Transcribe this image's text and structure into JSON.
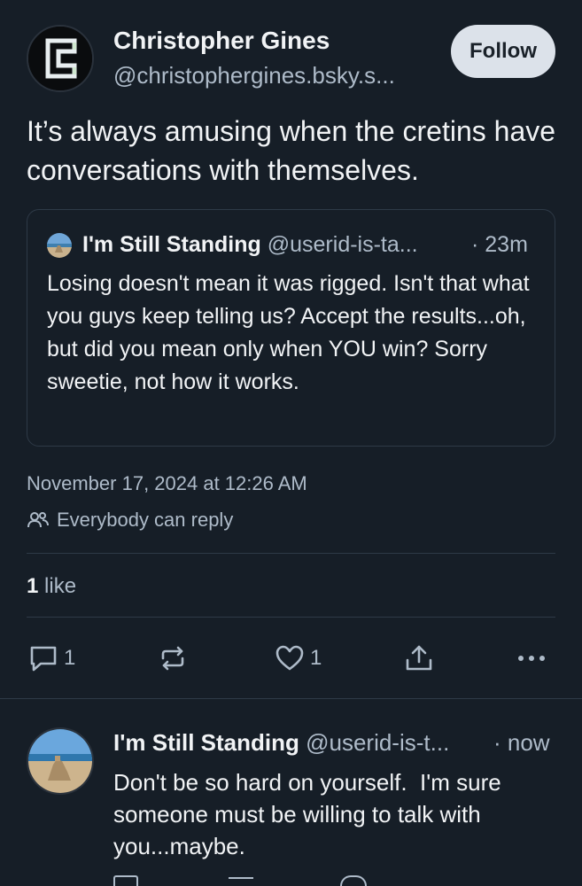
{
  "post": {
    "author_name": "Christopher Gines",
    "author_handle": "@christophergines.bsky.s...",
    "follow_label": "Follow",
    "text": "It’s always amusing when the cretins have conversations with themselves.",
    "quote": {
      "author_name": "I'm Still Standing",
      "author_handle": "@userid-is-ta...",
      "time": "· 23m",
      "text": "Losing doesn't mean it was rigged. Isn't that what you guys keep telling us? Accept the results...oh, but did you mean only when YOU win? Sorry sweetie, not how it works."
    },
    "timestamp": "November 17, 2024 at 12:26 AM",
    "reply_permission": "Everybody can reply",
    "likes_count": "1",
    "likes_label": "like",
    "actions": {
      "reply_count": "1",
      "repost_count": "",
      "like_count": "1"
    }
  },
  "reply": {
    "author_name": "I'm Still Standing",
    "author_handle": "@userid-is-t...",
    "time": "· now",
    "text": "Don't be so hard on yourself.  I'm sure someone must be willing to talk with you...maybe."
  },
  "icons": [
    "reply-icon",
    "repost-icon",
    "like-icon",
    "share-icon",
    "more-icon",
    "people-icon"
  ],
  "colors": {
    "background": "#161e27",
    "text_primary": "#f1f3f5",
    "text_secondary": "#aebbc9",
    "divider": "#2e3a47",
    "follow_button_bg": "#dce2ea"
  }
}
